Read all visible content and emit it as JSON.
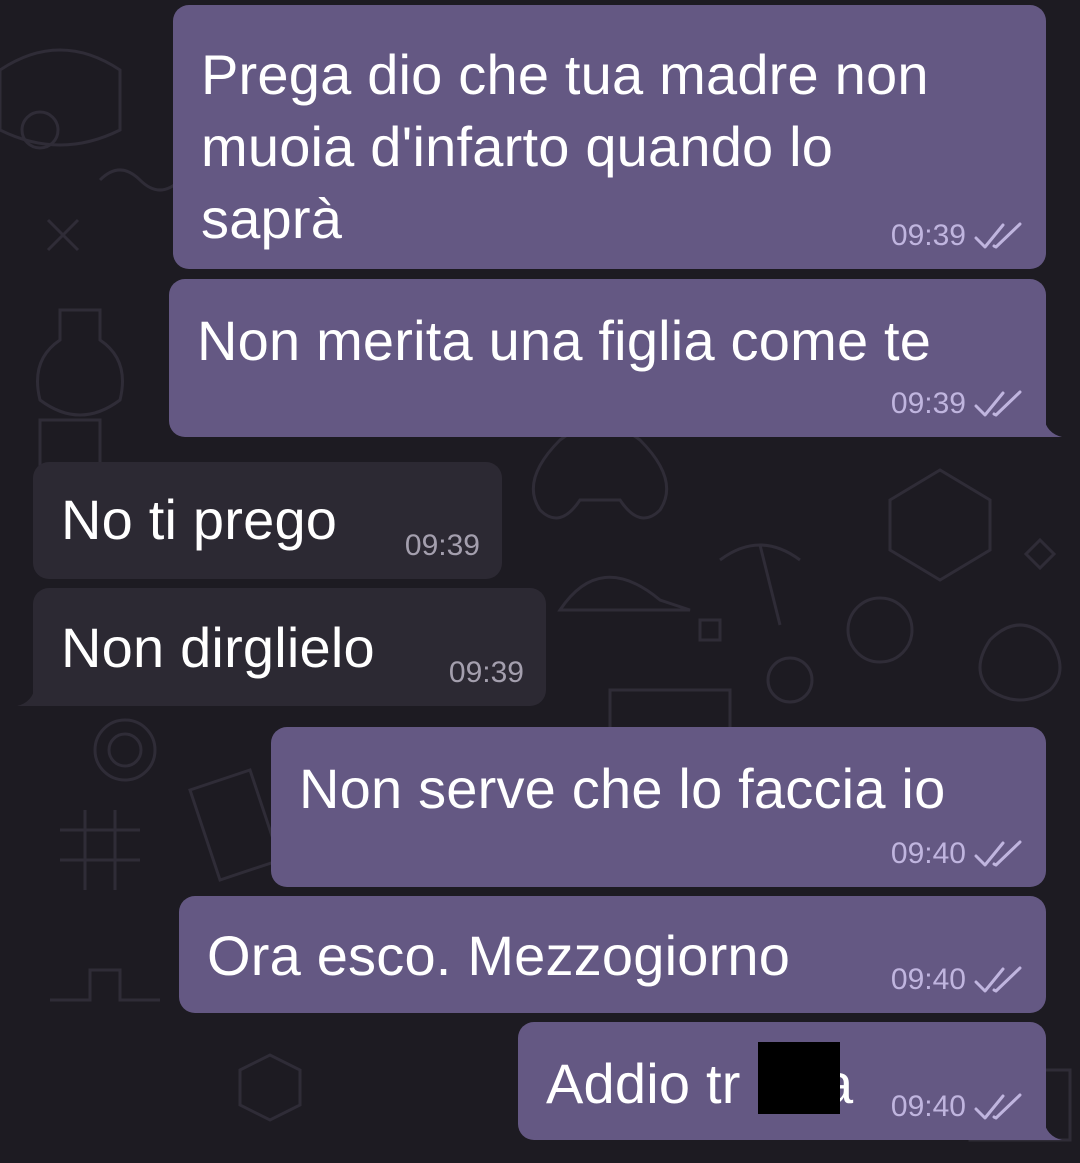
{
  "chat": {
    "messages": [
      {
        "direction": "outgoing",
        "lines": [
          "Prega dio che tua madre non",
          "muoia d'infarto quando lo",
          "saprà"
        ],
        "time": "09:39",
        "status": "double-check-icon"
      },
      {
        "direction": "outgoing",
        "text": "Non merita una figlia come te",
        "time": "09:39",
        "status": "double-check-icon"
      },
      {
        "direction": "incoming",
        "text": "No ti prego",
        "time": "09:39"
      },
      {
        "direction": "incoming",
        "text": "Non dirglielo",
        "time": "09:39"
      },
      {
        "direction": "outgoing",
        "text": "Non serve che lo faccia io",
        "time": "09:40",
        "status": "double-check-icon"
      },
      {
        "direction": "outgoing",
        "text": "Ora esco. Mezzogiorno",
        "time": "09:40",
        "status": "double-check-icon"
      },
      {
        "direction": "outgoing",
        "text_visible_start": "Addio tr",
        "text_visible_end": "a",
        "redacted": true,
        "time": "09:40",
        "status": "double-check-icon"
      }
    ]
  },
  "colors": {
    "background": "#1d1b22",
    "outgoing_bubble": "#645883",
    "incoming_bubble": "#2c2933",
    "outgoing_time": "#c0b5df",
    "incoming_time": "#a49fae",
    "check_marks": "#c0b5df",
    "redaction": "#000000"
  }
}
